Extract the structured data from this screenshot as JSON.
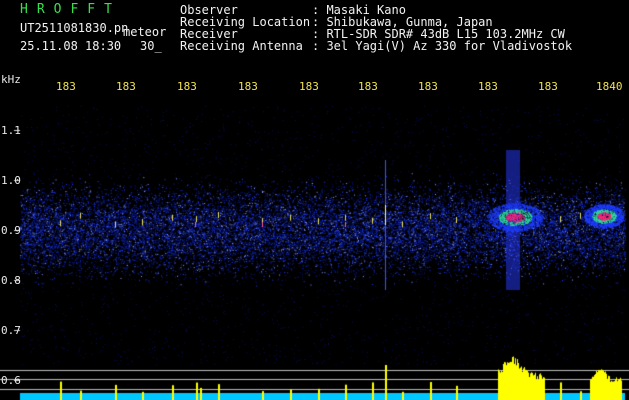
{
  "header": {
    "station_name": "HROFFT",
    "file_name": "UT2511081830.pn",
    "mode": "meteor",
    "datetime": "25.11.08 18:30",
    "duration": "30_",
    "fields": [
      {
        "label": "Observer",
        "value": ": Masaki Kano"
      },
      {
        "label": "Receiving Location",
        "value": ": Shibukawa, Gunma, Japan"
      },
      {
        "label": "Receiver",
        "value": ": RTL-SDR SDR# 43dB L15 103.2MHz CW"
      },
      {
        "label": "Receiving Antenna",
        "value": ": 3el Yagi(V) Az 330 for Vladivostok"
      }
    ]
  },
  "spectrogram": {
    "unit_label": "kHz",
    "y_ticks": [
      "1.1",
      "1.0",
      "0.9",
      "0.8",
      "0.7",
      "0.6"
    ],
    "time_labels": [
      "183",
      "183",
      "183",
      "183",
      "183",
      "183",
      "183",
      "183",
      "183",
      "1840"
    ],
    "colors": {
      "background": "#000000",
      "noise": "#1f3cff",
      "echo_core": "#ff2a7a",
      "echo_halo": "#33e0a0",
      "time_label": "#f2e34d",
      "spectrum": "#ffff00",
      "noise_floor": "#00c8ff"
    }
  }
}
